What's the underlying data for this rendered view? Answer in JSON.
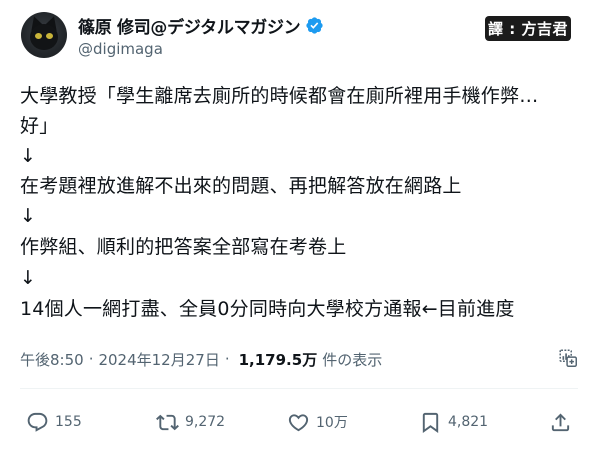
{
  "author": {
    "display_name": "篠原 修司@デジタルマガジン",
    "handle": "@digimaga",
    "avatar_icon": "black-cat-avatar",
    "verified_icon": "verified-badge-icon",
    "verified_color": "#1d9bf0"
  },
  "watermark": "譯 : 方吉君",
  "tweet": {
    "lines": [
      "大學教授「學生離席去廁所的時候都會在廁所裡用手機作弊…",
      "好」",
      "↓",
      "在考題裡放進解不出來的問題、再把解答放在網路上",
      "↓",
      "作弊組、順利的把答案全部寫在考卷上",
      "↓",
      "14個人一網打盡、全員0分同時向大學校方通報←目前進度"
    ]
  },
  "meta": {
    "time": "午後8:50",
    "separator": "·",
    "date": "2024年12月27日",
    "views_count": "1,179.5万",
    "views_label": "件の表示",
    "analytics_icon": "analytics-icon"
  },
  "actions": {
    "reply": {
      "icon": "reply-icon",
      "count": "155"
    },
    "retweet": {
      "icon": "retweet-icon",
      "count": "9,272"
    },
    "like": {
      "icon": "heart-icon",
      "count": "10万"
    },
    "bookmark": {
      "icon": "bookmark-icon",
      "count": "4,821"
    },
    "share": {
      "icon": "share-icon"
    }
  },
  "colors": {
    "text_primary": "#0f1419",
    "text_secondary": "#536471",
    "accent": "#1d9bf0",
    "divider": "#eff3f4"
  }
}
